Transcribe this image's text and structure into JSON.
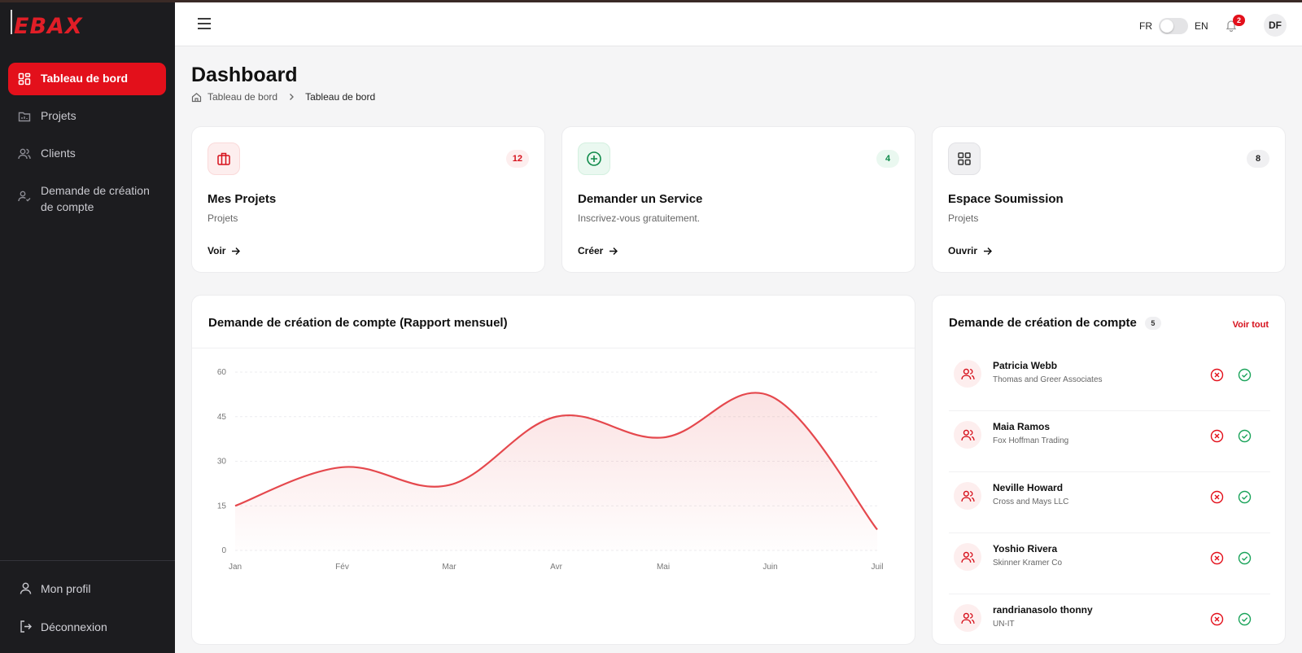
{
  "app": {
    "logo_text": "EBAX"
  },
  "sidebar": {
    "items": [
      {
        "label": "Tableau de bord",
        "icon": "dashboard-icon",
        "active": true
      },
      {
        "label": "Projets",
        "icon": "folder-icon"
      },
      {
        "label": "Clients",
        "icon": "users-icon"
      },
      {
        "label": "Demande de création de compte",
        "icon": "user-check-icon"
      }
    ],
    "bottom": {
      "profile": "Mon profil",
      "logout": "Déconnexion"
    }
  },
  "topbar": {
    "lang_left": "FR",
    "lang_right": "EN",
    "notifications": "2",
    "user_initials": "DF"
  },
  "header": {
    "title": "Dashboard",
    "breadcrumb": [
      "Tableau de bord",
      "Tableau de bord"
    ]
  },
  "cards": [
    {
      "title": "Mes Projets",
      "subtitle": "Projets",
      "count": "12",
      "link": "Voir",
      "icon": "briefcase-icon",
      "color": "#d6101b"
    },
    {
      "title": "Demander un Service",
      "subtitle": "Inscrivez-vous gratuitement.",
      "count": "4",
      "link": "Créer",
      "icon": "plus-circle-icon",
      "color": "#0f8a4a"
    },
    {
      "title": "Espace Soumission",
      "subtitle": "Projets",
      "count": "8",
      "link": "Ouvrir",
      "icon": "grid-icon",
      "color": "#333333"
    }
  ],
  "chart_panel": {
    "title": "Demande de création de compte (Rapport mensuel)"
  },
  "chart_data": {
    "type": "area",
    "categories": [
      "Jan",
      "Fév",
      "Mar",
      "Avr",
      "Mai",
      "Juin",
      "Juil"
    ],
    "series": [
      {
        "values": [
          15,
          28,
          22,
          45,
          38,
          52,
          7
        ]
      }
    ],
    "ylim": [
      0,
      60
    ],
    "yticks": [
      0,
      15,
      30,
      45,
      60
    ],
    "grid": true,
    "color": "#e5484d"
  },
  "requests": {
    "title": "Demande de création de compte",
    "count": "5",
    "view_all": "Voir tout",
    "items": [
      {
        "name": "Patricia Webb",
        "company": "Thomas and Greer Associates"
      },
      {
        "name": "Maia Ramos",
        "company": "Fox Hoffman Trading"
      },
      {
        "name": "Neville Howard",
        "company": "Cross and Mays LLC"
      },
      {
        "name": "Yoshio Rivera",
        "company": "Skinner Kramer Co"
      },
      {
        "name": "randrianasolo thonny",
        "company": "UN-IT"
      }
    ]
  }
}
